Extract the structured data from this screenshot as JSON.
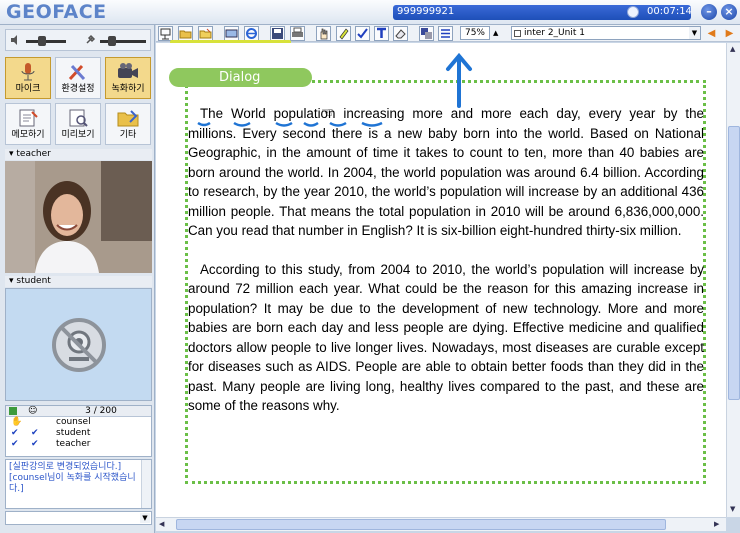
{
  "app": {
    "logo": "GEOFACE",
    "user_id": "999999921",
    "elapsed_time": "00:07:14"
  },
  "left_tools": [
    {
      "label": "마이크",
      "icon": "microphone-icon",
      "active": true
    },
    {
      "label": "환경설정",
      "icon": "settings-tools-icon",
      "active": false
    },
    {
      "label": "녹화하기",
      "icon": "video-camera-icon",
      "active": true
    },
    {
      "label": "메모하기",
      "icon": "memo-icon",
      "active": false
    },
    {
      "label": "미리보기",
      "icon": "preview-icon",
      "active": false
    },
    {
      "label": "기타",
      "icon": "folder-icon",
      "active": false
    }
  ],
  "panels": {
    "teacher_label": "teacher",
    "student_label": "student"
  },
  "roster": {
    "count": "3 / 200",
    "members": [
      {
        "name": "counsel"
      },
      {
        "name": "student"
      },
      {
        "name": "teacher"
      }
    ]
  },
  "chat": {
    "messages": [
      "[실판강의로 변경되었습니다.]",
      "[counsel님이 녹화를 시작했습니다.]"
    ]
  },
  "toolbar": {
    "zoom": "75%",
    "unit": "inter 2_Unit 1"
  },
  "document": {
    "heading": "Dialog",
    "paragraphs": [
      "The World population increasing more and more each day, every year by the millions.  Every second there is a new baby born into the world.  Based on National Geographic, in the amount of time it takes to count to ten, more than 40 babies are born around the world.  In 2004, the world population was around 6.4 billion.  According to research, by the year 2010, the world’s population will increase by an additional 436 million people.  That means the total population in 2010 will be around 6,836,000,000.  Can you read that number in English?  It is six-billion eight-hundred thirty-six million.",
      "According to this study, from 2004 to 2010, the world’s population will increase by around 72 million each year.  What could  be the reason for this amazing increase in population?  It may be due to the development of new technology.  More and more babies are born each day and less people are dying.  Effective medicine and qualified doctors allow people to live longer lives.  Nowadays, most diseases are curable except for diseases such as AIDS.  People are able to obtain better foods than they did in the past.  Many people are living long, healthy lives compared to the past, and these are some of the reasons why."
    ]
  },
  "colors": {
    "accent_blue": "#2a64d6",
    "dialog_green": "#8fc85e",
    "dotted_green": "#6bbf47",
    "highlight_yellow": "#d8e23a",
    "annotation_blue": "#1f74d4"
  }
}
